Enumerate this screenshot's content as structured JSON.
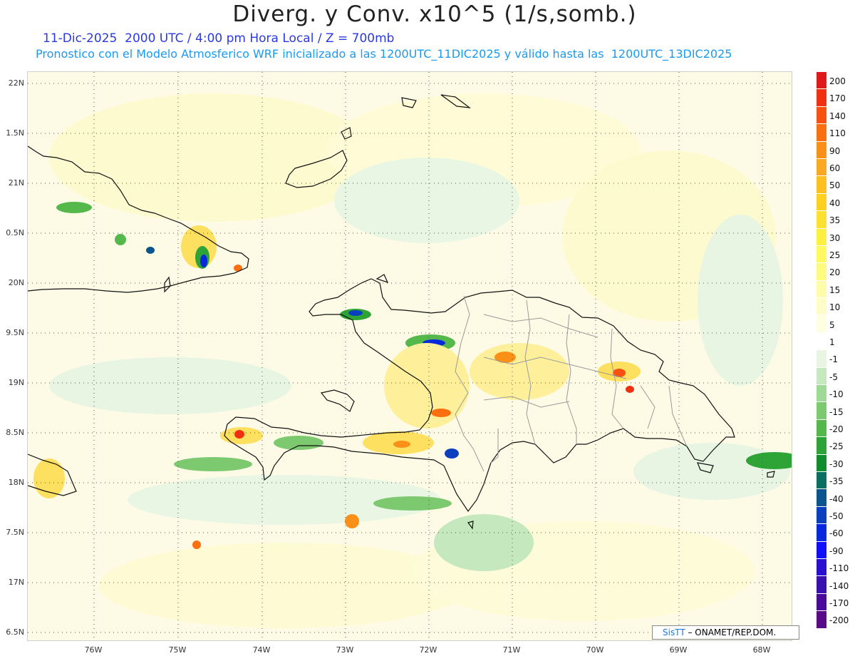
{
  "header": {
    "title": "Diverg. y Conv. x10^5 (1/s,somb.)",
    "subtitle_time": "11-Dic-2025  2000 UTC / 4:00 pm Hora Local / Z = 700mb",
    "subtitle_model": "Pronostico con el Modelo Atmosferico WRF inicializado a las 1200UTC_11DIC2025 y válido hasta las  1200UTC_13DIC2025"
  },
  "axes": {
    "lat_labels": [
      "22N",
      "1.5N",
      "21N",
      "0.5N",
      "20N",
      "9.5N",
      "19N",
      "8.5N",
      "18N",
      "7.5N",
      "17N",
      "6.5N"
    ],
    "lon_labels": [
      "76W",
      "75W",
      "74W",
      "73W",
      "72W",
      "71W",
      "70W",
      "69W",
      "68W"
    ]
  },
  "colorbar": {
    "labels": [
      "200",
      "170",
      "140",
      "110",
      "90",
      "60",
      "50",
      "40",
      "35",
      "30",
      "25",
      "20",
      "15",
      "10",
      "5",
      "1",
      "-1",
      "-5",
      "-10",
      "-15",
      "-20",
      "-25",
      "-30",
      "-35",
      "-40",
      "-50",
      "-60",
      "-90",
      "-110",
      "-140",
      "-170",
      "-200"
    ],
    "colors": [
      "#e01818",
      "#f03010",
      "#f85010",
      "#fa7010",
      "#fb9018",
      "#fca820",
      "#fdc020",
      "#fed020",
      "#fee030",
      "#fef040",
      "#fefa60",
      "#fefc80",
      "#fefca8",
      "#fefdc8",
      "#fefee0",
      "#ffffff",
      "#e8f5e3",
      "#c5e8bf",
      "#9fd996",
      "#7cc96f",
      "#55b84a",
      "#2fa436",
      "#0f8c2c",
      "#0a6e60",
      "#0a5590",
      "#0a40c0",
      "#0828e0",
      "#1010ff",
      "#2a10d0",
      "#3a10b0",
      "#4a0a9a",
      "#580a88"
    ]
  },
  "credit": {
    "sis": "SisTT",
    "org": " – ONAMET/REP.DOM."
  },
  "colors": {
    "land_outline": "#111111",
    "province_outline": "#999999",
    "grid": "#555555"
  }
}
